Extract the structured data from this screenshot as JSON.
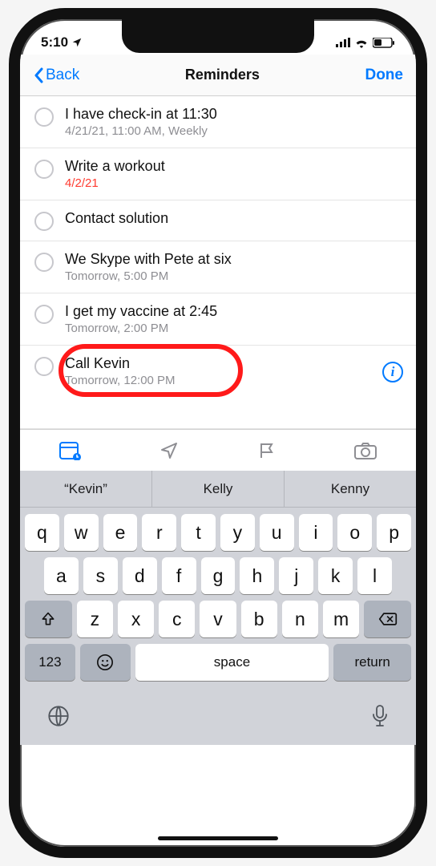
{
  "status": {
    "time": "5:10"
  },
  "nav": {
    "back": "Back",
    "title": "Reminders",
    "done": "Done"
  },
  "reminders": [
    {
      "title": "I have check-in at 11:30",
      "sub": "4/21/21, 11:00 AM, Weekly",
      "overdue": false,
      "info": false,
      "highlight": false
    },
    {
      "title": "Write a workout",
      "sub": "4/2/21",
      "overdue": true,
      "info": false,
      "highlight": false
    },
    {
      "title": "Contact solution",
      "sub": "",
      "overdue": false,
      "info": false,
      "highlight": false
    },
    {
      "title": "We Skype with Pete at six",
      "sub": "Tomorrow, 5:00 PM",
      "overdue": false,
      "info": false,
      "highlight": false
    },
    {
      "title": "I get my vaccine at 2:45",
      "sub": "Tomorrow, 2:00 PM",
      "overdue": false,
      "info": false,
      "highlight": false
    },
    {
      "title": "Call Kevin",
      "sub": "Tomorrow, 12:00 PM",
      "overdue": false,
      "info": true,
      "highlight": true
    }
  ],
  "toolbar": {
    "calendar": "calendar",
    "location": "location",
    "flag": "flag",
    "camera": "camera"
  },
  "suggestions": [
    "“Kevin”",
    "Kelly",
    "Kenny"
  ],
  "keyboard": {
    "row1": [
      "q",
      "w",
      "e",
      "r",
      "t",
      "y",
      "u",
      "i",
      "o",
      "p"
    ],
    "row2": [
      "a",
      "s",
      "d",
      "f",
      "g",
      "h",
      "j",
      "k",
      "l"
    ],
    "row3": [
      "z",
      "x",
      "c",
      "v",
      "b",
      "n",
      "m"
    ],
    "numLabel": "123",
    "space": "space",
    "return": "return"
  }
}
